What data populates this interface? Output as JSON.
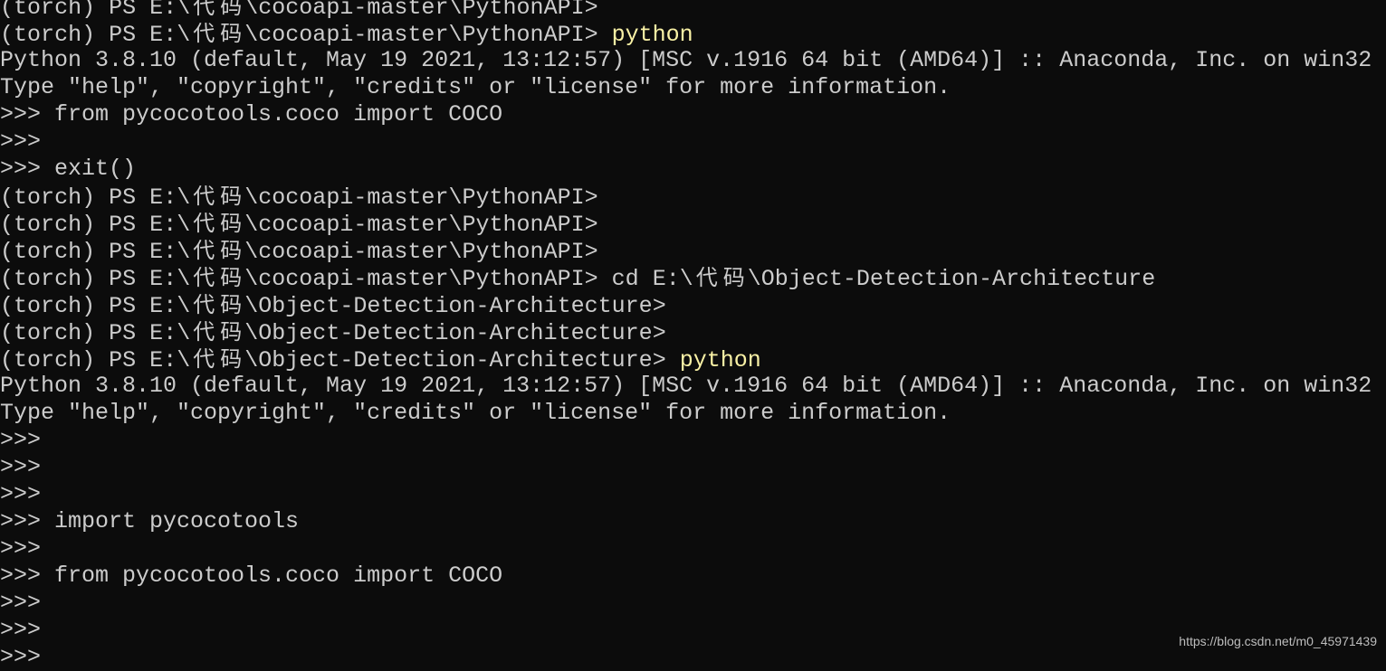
{
  "colors": {
    "background": "#0c0c0c",
    "text": "#cccccc",
    "command_highlight": "#f9f1a5"
  },
  "terminal": {
    "lines": [
      {
        "text": "(torch) PS E:\\代码\\cocoapi-master\\PythonAPI>",
        "cmd": ""
      },
      {
        "text": "(torch) PS E:\\代码\\cocoapi-master\\PythonAPI> ",
        "cmd": "python",
        "highlight": true
      },
      {
        "text": "Python 3.8.10 (default, May 19 2021, 13:12:57) [MSC v.1916 64 bit (AMD64)] :: Anaconda, Inc. on win32",
        "cmd": ""
      },
      {
        "text": "Type \"help\", \"copyright\", \"credits\" or \"license\" for more information.",
        "cmd": ""
      },
      {
        "text": ">>> from pycocotools.coco import COCO",
        "cmd": ""
      },
      {
        "text": ">>>",
        "cmd": ""
      },
      {
        "text": ">>> exit()",
        "cmd": ""
      },
      {
        "text": "(torch) PS E:\\代码\\cocoapi-master\\PythonAPI>",
        "cmd": ""
      },
      {
        "text": "(torch) PS E:\\代码\\cocoapi-master\\PythonAPI>",
        "cmd": ""
      },
      {
        "text": "(torch) PS E:\\代码\\cocoapi-master\\PythonAPI>",
        "cmd": ""
      },
      {
        "text": "(torch) PS E:\\代码\\cocoapi-master\\PythonAPI> ",
        "cmd": "cd E:\\代码\\Object-Detection-Architecture",
        "highlight": false
      },
      {
        "text": "(torch) PS E:\\代码\\Object-Detection-Architecture>",
        "cmd": ""
      },
      {
        "text": "(torch) PS E:\\代码\\Object-Detection-Architecture>",
        "cmd": ""
      },
      {
        "text": "(torch) PS E:\\代码\\Object-Detection-Architecture> ",
        "cmd": "python",
        "highlight": true
      },
      {
        "text": "Python 3.8.10 (default, May 19 2021, 13:12:57) [MSC v.1916 64 bit (AMD64)] :: Anaconda, Inc. on win32",
        "cmd": ""
      },
      {
        "text": "Type \"help\", \"copyright\", \"credits\" or \"license\" for more information.",
        "cmd": ""
      },
      {
        "text": ">>>",
        "cmd": ""
      },
      {
        "text": ">>>",
        "cmd": ""
      },
      {
        "text": ">>>",
        "cmd": ""
      },
      {
        "text": ">>> import pycocotools",
        "cmd": ""
      },
      {
        "text": ">>>",
        "cmd": ""
      },
      {
        "text": ">>> from pycocotools.coco import COCO",
        "cmd": ""
      },
      {
        "text": ">>>",
        "cmd": ""
      },
      {
        "text": ">>>",
        "cmd": ""
      },
      {
        "text": ">>>",
        "cmd": ""
      }
    ]
  },
  "watermark": "https://blog.csdn.net/m0_45971439"
}
